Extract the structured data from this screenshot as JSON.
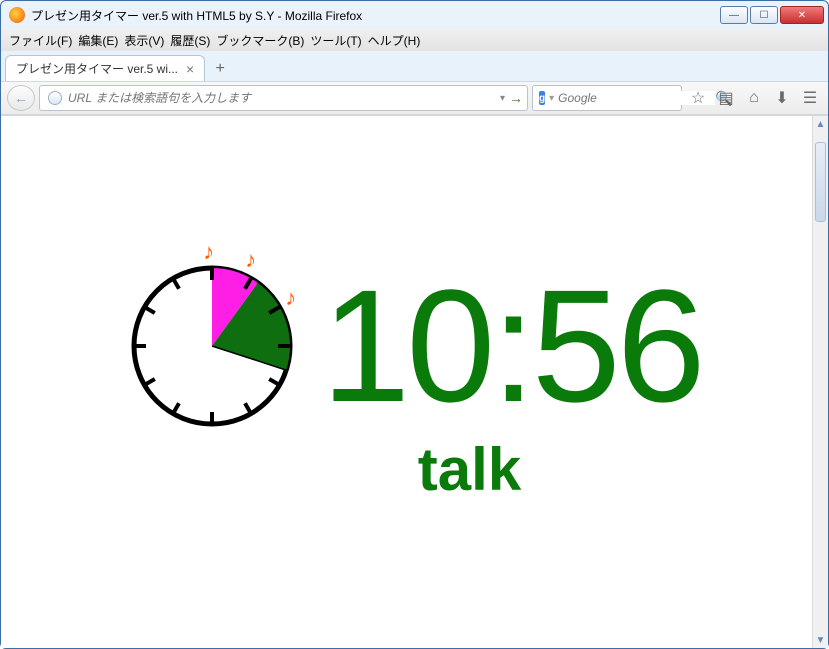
{
  "window": {
    "title": "プレゼン用タイマー ver.5 with HTML5 by S.Y - Mozilla Firefox"
  },
  "menubar": {
    "file": "ファイル(F)",
    "edit": "編集(E)",
    "view": "表示(V)",
    "history": "履歴(S)",
    "bookmarks": "ブックマーク(B)",
    "tools": "ツール(T)",
    "help": "ヘルプ(H)"
  },
  "tab": {
    "title": "プレゼン用タイマー ver.5 wi..."
  },
  "urlbar": {
    "placeholder": "URL または検索語句を入力します"
  },
  "searchbar": {
    "engine_glyph": "g",
    "placeholder": "Google"
  },
  "timer": {
    "display": "10:56",
    "label": "talk"
  },
  "chart_data": {
    "type": "pie",
    "title": "",
    "clock_face_ticks": 12,
    "hand_angle_deg": 108,
    "series": [
      {
        "name": "segment-magenta",
        "start_deg": 0,
        "end_deg": 36,
        "color": "#ff1ee6"
      },
      {
        "name": "segment-green",
        "start_deg": 36,
        "end_deg": 108,
        "color": "#0f6e0f"
      }
    ],
    "bell_markers_deg": [
      0,
      36,
      108
    ]
  }
}
